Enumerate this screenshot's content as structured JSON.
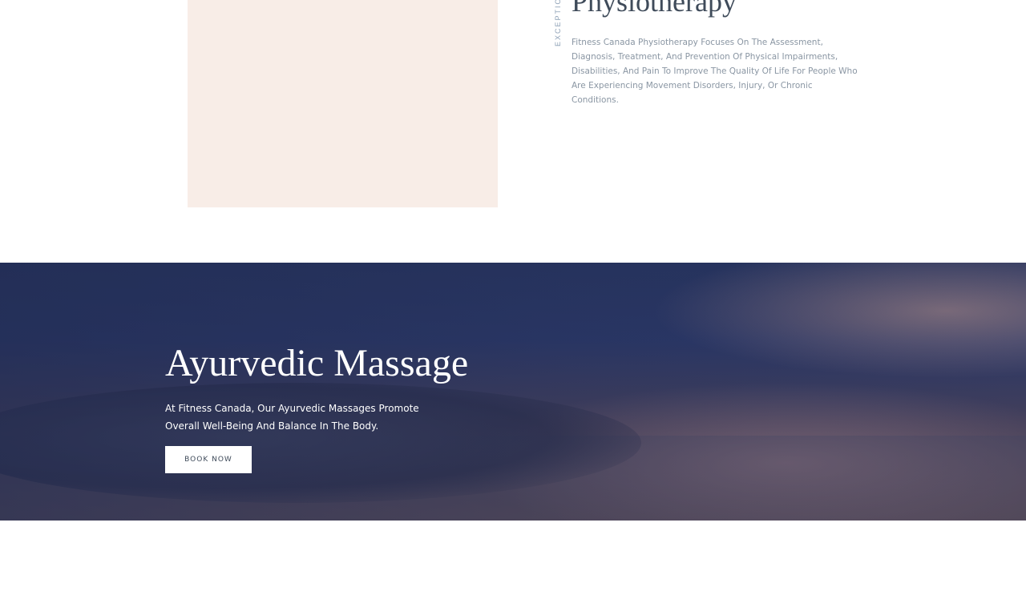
{
  "intro": {
    "vertical_label": "EXCEPTION",
    "title": "Physiotherapy",
    "description": "Fitness Canada Physiotherapy Focuses On The Assessment, Diagnosis, Treatment, And Prevention Of Physical Impairments, Disabilities, And Pain To Improve The Quality Of Life For People Who Are Experiencing Movement Disorders, Injury, Or Chronic Conditions."
  },
  "hero": {
    "title": "Ayurvedic Massage",
    "text": "At Fitness Canada, Our Ayurvedic Massages Promote Overall Well-Being And Balance In The Body.",
    "button_label": "BOOK NOW"
  },
  "colors": {
    "image_placeholder": "#f8ede7",
    "title_text": "#3f4b5a",
    "body_text": "#8a96a3",
    "label_text": "#8ea1b6",
    "hero_base": "#27345f"
  }
}
